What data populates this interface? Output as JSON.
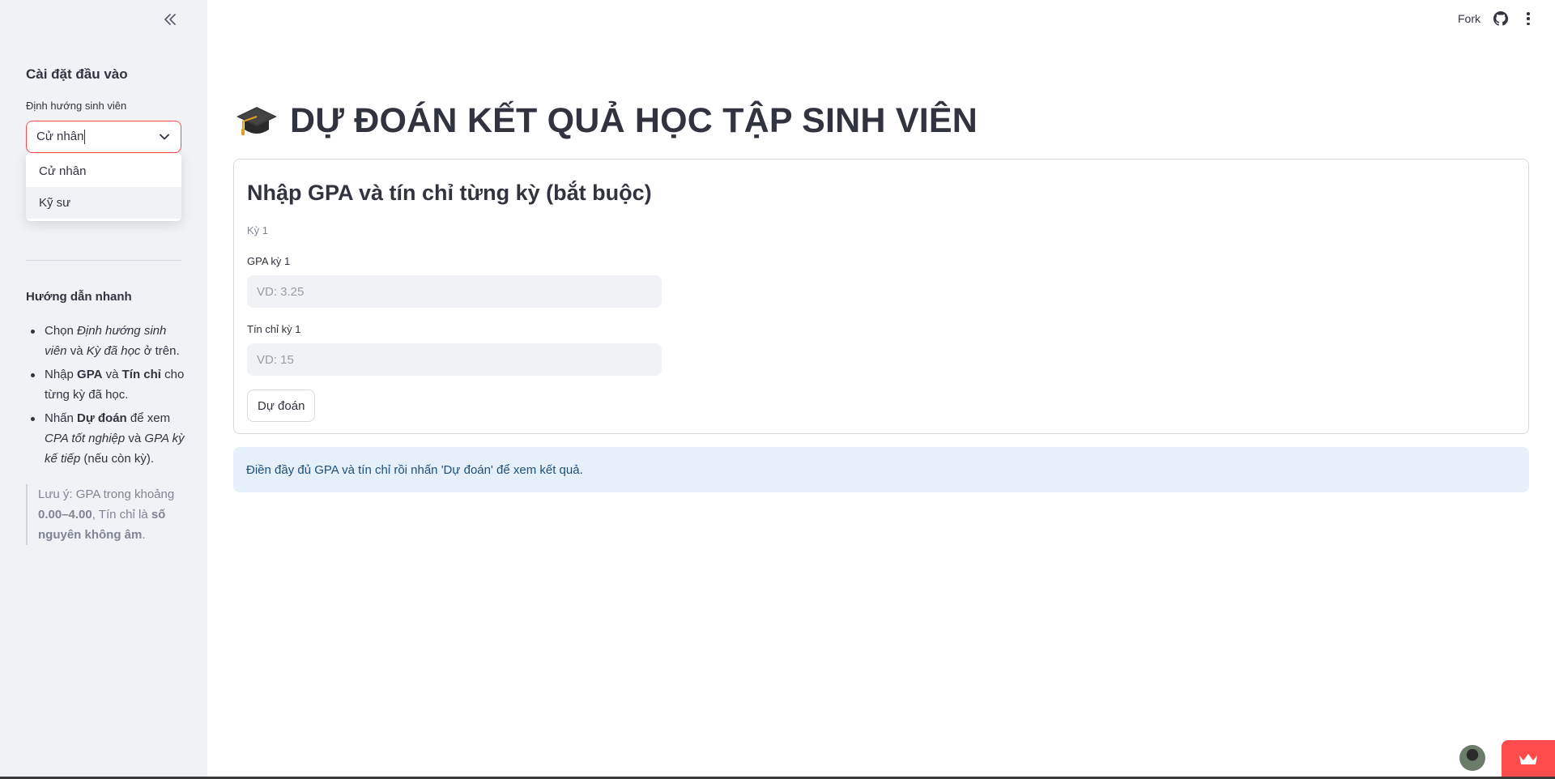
{
  "sidebar": {
    "header": "Cài đặt đầu vào",
    "select_label": "Định hướng sinh viên",
    "select_value": "Cử nhân",
    "options": [
      "Cử nhân",
      "Kỹ sư"
    ],
    "guide_title": "Hướng dẫn nhanh",
    "guide_items": [
      {
        "parts": [
          {
            "t": "Chọn ",
            "s": "n"
          },
          {
            "t": "Định hướng sinh viên",
            "s": "i"
          },
          {
            "t": " và ",
            "s": "n"
          },
          {
            "t": "Kỳ đã học",
            "s": "i"
          },
          {
            "t": " ở trên.",
            "s": "n"
          }
        ]
      },
      {
        "parts": [
          {
            "t": "Nhập ",
            "s": "n"
          },
          {
            "t": "GPA",
            "s": "b"
          },
          {
            "t": " và ",
            "s": "n"
          },
          {
            "t": "Tín chỉ",
            "s": "b"
          },
          {
            "t": " cho từng kỳ đã học.",
            "s": "n"
          }
        ]
      },
      {
        "parts": [
          {
            "t": "Nhấn ",
            "s": "n"
          },
          {
            "t": "Dự đoán",
            "s": "b"
          },
          {
            "t": " để xem ",
            "s": "n"
          },
          {
            "t": "CPA tốt nghiệp",
            "s": "i"
          },
          {
            "t": " và ",
            "s": "n"
          },
          {
            "t": "GPA kỳ kế tiếp",
            "s": "i"
          },
          {
            "t": " (nếu còn kỳ).",
            "s": "n"
          }
        ]
      }
    ],
    "note": {
      "prefix": "Lưu ý: GPA trong khoảng ",
      "range": "0.00–4.00",
      "middle": ", Tín chỉ là ",
      "integer": "số nguyên không âm",
      "suffix": "."
    }
  },
  "topbar": {
    "fork_label": "Fork"
  },
  "main": {
    "title": "DỰ ĐOÁN KẾT QUẢ HỌC TẬP SINH VIÊN",
    "form": {
      "title": "Nhập GPA và tín chỉ từng kỳ (bắt buộc)",
      "semester_label": "Kỳ 1",
      "gpa_label": "GPA kỳ 1",
      "gpa_placeholder": "VD: 3.25",
      "gpa_value": "",
      "credit_label": "Tín chỉ kỳ 1",
      "credit_placeholder": "VD: 15",
      "credit_value": "",
      "predict_label": "Dự đoán"
    },
    "info": "Điền đầy đủ GPA và tín chỉ rồi nhấn 'Dự đoán' để xem kết quả."
  },
  "colors": {
    "primary": "#ff4b4b",
    "sidebar_bg": "#f0f2f6",
    "info_bg": "#e6f0fb",
    "info_text": "#1d4f7a",
    "text": "#31333f"
  },
  "icons": [
    "collapse-sidebar-icon",
    "chevron-down-icon",
    "github-icon",
    "kebab-menu-icon",
    "graduation-cap-icon",
    "crown-icon"
  ]
}
